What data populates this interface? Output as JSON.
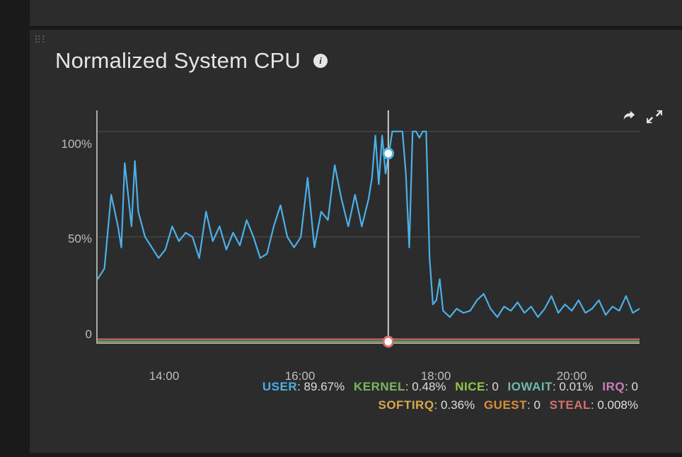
{
  "panel": {
    "title": "Normalized System CPU"
  },
  "ylabels": {
    "l100": "100%",
    "l50": "50%",
    "l0": "0"
  },
  "xlabels": {
    "t14": "14:00",
    "t16": "16:00",
    "t18": "18:00",
    "t20": "20:00"
  },
  "legend": {
    "user": {
      "name": "USER",
      "value": ": 89.67%",
      "color": "#4bb0e8"
    },
    "kernel": {
      "name": "KERNEL",
      "value": ": 0.48%",
      "color": "#7bb661"
    },
    "nice": {
      "name": "NICE",
      "value": ": 0",
      "color": "#8fc94a"
    },
    "iowait": {
      "name": "IOWAIT",
      "value": ": 0.01%",
      "color": "#6fb8b0"
    },
    "irq": {
      "name": "IRQ",
      "value": ": 0",
      "color": "#c77fb4"
    },
    "softirq": {
      "name": "SOFTIRQ",
      "value": ": 0.36%",
      "color": "#d6a84f"
    },
    "guest": {
      "name": "GUEST",
      "value": ": 0",
      "color": "#d88f3b"
    },
    "steal": {
      "name": "STEAL",
      "value": ": 0.008%",
      "color": "#d66f6f"
    }
  },
  "chart_data": {
    "type": "line",
    "title": "Normalized System CPU",
    "ylabel": "%",
    "ylim": [
      0,
      110
    ],
    "x_range_hours": [
      13,
      21
    ],
    "cursor_time": 17.3,
    "cursor_values": {
      "USER": 89.67,
      "KERNEL": 0.48,
      "NICE": 0,
      "IOWAIT": 0.01,
      "IRQ": 0,
      "SOFTIRQ": 0.36,
      "GUEST": 0,
      "STEAL": 0.008
    },
    "series": [
      {
        "name": "USER",
        "color": "#4bb0e8",
        "x_hours": [
          13.0,
          13.1,
          13.2,
          13.3,
          13.35,
          13.4,
          13.5,
          13.55,
          13.6,
          13.7,
          13.8,
          13.9,
          14.0,
          14.1,
          14.2,
          14.3,
          14.4,
          14.5,
          14.6,
          14.7,
          14.8,
          14.9,
          15.0,
          15.1,
          15.2,
          15.3,
          15.4,
          15.5,
          15.6,
          15.7,
          15.8,
          15.9,
          16.0,
          16.1,
          16.2,
          16.3,
          16.4,
          16.5,
          16.6,
          16.7,
          16.8,
          16.9,
          17.0,
          17.05,
          17.1,
          17.15,
          17.2,
          17.25,
          17.3,
          17.35,
          17.4,
          17.5,
          17.55,
          17.6,
          17.65,
          17.7,
          17.75,
          17.8,
          17.85,
          17.9,
          17.95,
          18.0,
          18.05,
          18.1,
          18.2,
          18.3,
          18.4,
          18.5,
          18.6,
          18.7,
          18.8,
          18.9,
          19.0,
          19.1,
          19.2,
          19.3,
          19.4,
          19.5,
          19.6,
          19.7,
          19.8,
          19.9,
          20.0,
          20.1,
          20.2,
          20.3,
          20.4,
          20.5,
          20.6,
          20.7,
          20.8,
          20.9,
          21.0
        ],
        "values": [
          30,
          35,
          70,
          55,
          45,
          85,
          55,
          86,
          62,
          50,
          45,
          40,
          44,
          55,
          48,
          52,
          50,
          40,
          62,
          48,
          55,
          44,
          52,
          46,
          58,
          50,
          40,
          42,
          55,
          65,
          50,
          45,
          50,
          78,
          45,
          62,
          58,
          84,
          68,
          55,
          70,
          55,
          68,
          78,
          98,
          75,
          98,
          80,
          89.67,
          100,
          100,
          100,
          80,
          45,
          100,
          100,
          97,
          100,
          100,
          40,
          18,
          20,
          30,
          15,
          12,
          16,
          14,
          15,
          20,
          23,
          16,
          12,
          17,
          15,
          19,
          14,
          17,
          12,
          16,
          22,
          14,
          18,
          15,
          20,
          14,
          16,
          20,
          13,
          17,
          15,
          22,
          14,
          16
        ]
      },
      {
        "name": "STEAL",
        "color": "#d66f6f",
        "x_hours": [
          13.0,
          21.0
        ],
        "values": [
          1.5,
          1.5
        ]
      },
      {
        "name": "KERNEL",
        "color": "#7bb661",
        "x_hours": [
          13.0,
          21.0
        ],
        "values": [
          0.5,
          0.5
        ]
      }
    ]
  }
}
